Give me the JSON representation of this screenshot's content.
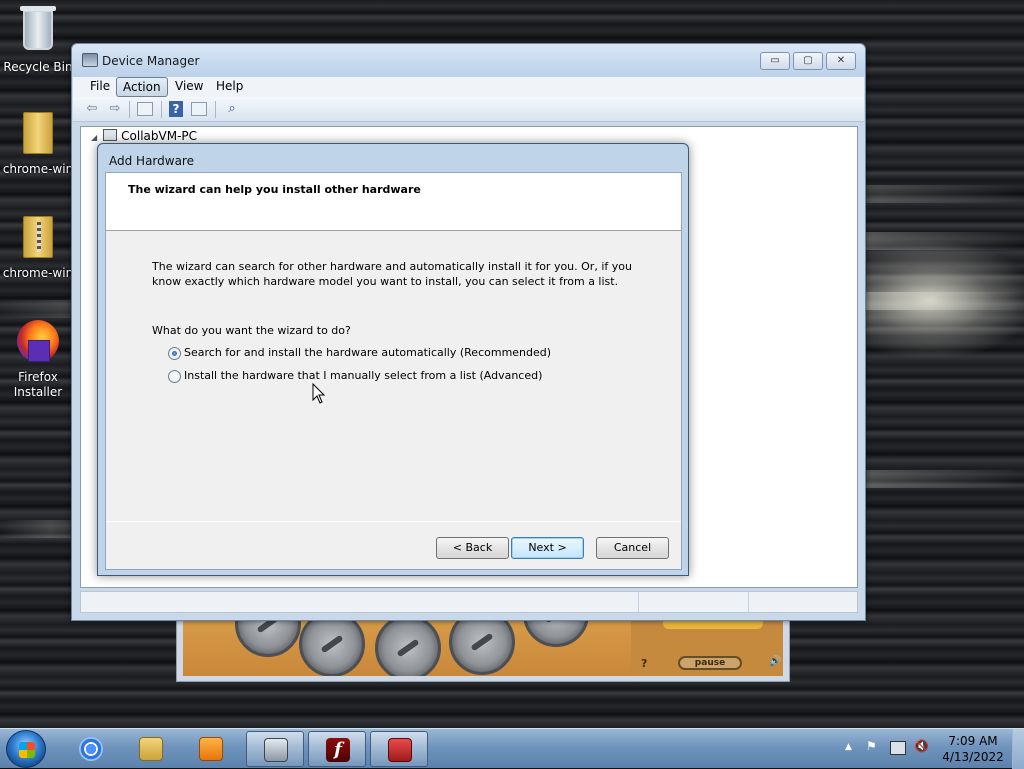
{
  "desktop": {
    "icons": [
      {
        "label": "Recycle Bin",
        "icon": "recycle-bin-icon"
      },
      {
        "label": "chrome-win",
        "icon": "folder-icon"
      },
      {
        "label": "chrome-win",
        "icon": "zip-folder-icon"
      },
      {
        "label": "Firefox Installer",
        "icon": "firefox-installer-icon"
      }
    ]
  },
  "game_window": {
    "pause_label": "pause",
    "help_glyph": "?",
    "sound_glyph": "🔊"
  },
  "device_manager": {
    "title": "Device Manager",
    "menu": [
      "File",
      "Action",
      "View",
      "Help"
    ],
    "active_menu": "Action",
    "toolbar_icons": [
      "back-arrow-icon",
      "forward-arrow-icon",
      "show-hide-console-tree-icon",
      "help-icon",
      "action-pane-icon",
      "scan-hardware-icon"
    ],
    "tree_root": "CollabVM-PC",
    "window_buttons": {
      "minimize": "▭",
      "maximize": "▢",
      "close": "✕"
    }
  },
  "wizard": {
    "title": "Add Hardware",
    "header": "The wizard can help you install other hardware",
    "description_line1": "The wizard can search for other hardware and automatically install it for you. Or, if you",
    "description_line2": "know exactly which hardware model you want to install, you can select it from a list.",
    "question": "What do you want the wizard to do?",
    "options": [
      {
        "label": "Search for and install the hardware automatically (Recommended)",
        "selected": true
      },
      {
        "label": "Install the hardware that I manually select from a list (Advanced)",
        "selected": false
      }
    ],
    "buttons": {
      "back": "< Back",
      "next": "Next >",
      "cancel": "Cancel"
    }
  },
  "taskbar": {
    "apps": [
      "chrome-icon",
      "file-explorer-icon",
      "media-player-icon",
      "device-manager-icon",
      "flash-player-icon",
      "toolbox-icon"
    ],
    "active_app": "device-manager-icon",
    "tray_icons": [
      "show-hidden-icons-chevron",
      "action-center-flag-icon",
      "network-error-icon",
      "volume-muted-icon"
    ],
    "time": "7:09 AM",
    "date": "4/13/2022"
  },
  "colors": {
    "title_bar": "#c8dbef",
    "taskbar": "#6f94bd",
    "default_button_border": "#3c7fb1"
  }
}
